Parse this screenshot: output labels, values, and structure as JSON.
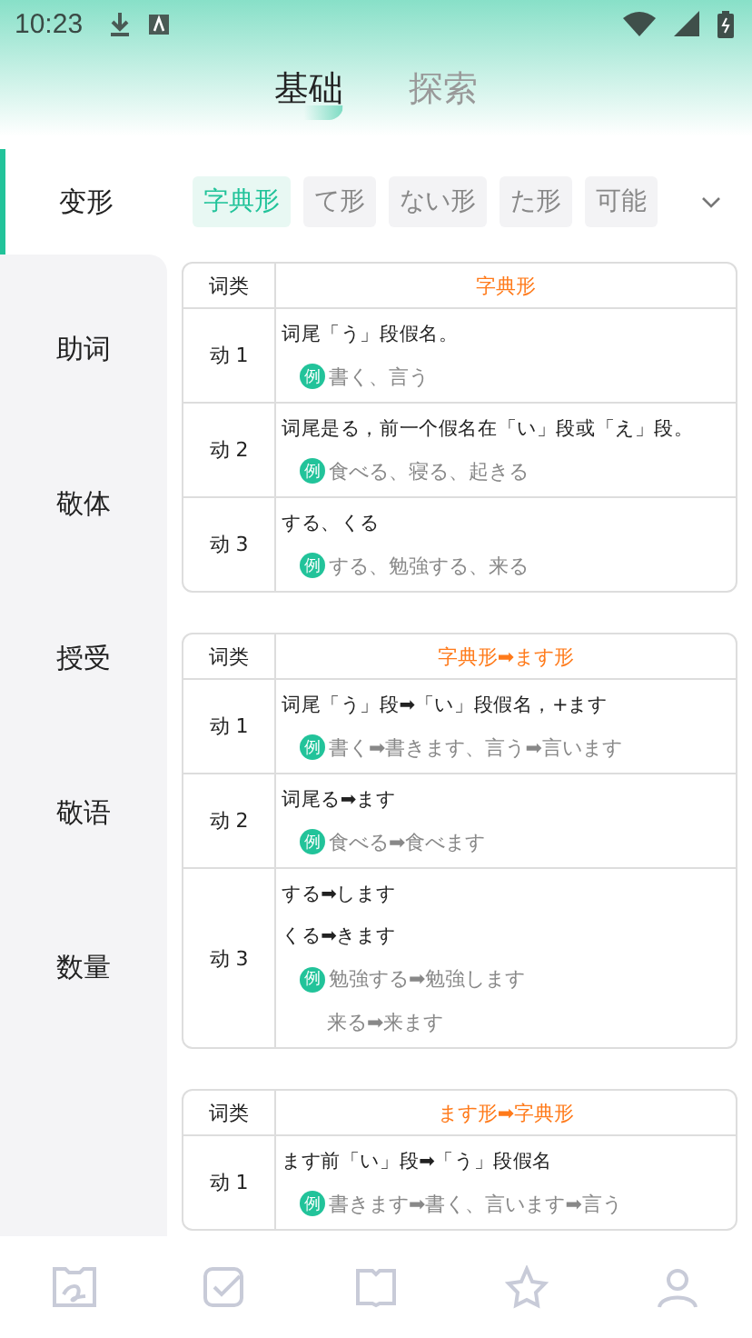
{
  "status_bar": {
    "time": "10:23"
  },
  "top_tabs": [
    {
      "label": "基础",
      "selected": true
    },
    {
      "label": "探索",
      "selected": false
    }
  ],
  "sidebar": {
    "items": [
      {
        "label": "变形",
        "selected": true
      },
      {
        "label": "助词",
        "selected": false
      },
      {
        "label": "敬体",
        "selected": false
      },
      {
        "label": "授受",
        "selected": false
      },
      {
        "label": "敬语",
        "selected": false
      },
      {
        "label": "数量",
        "selected": false
      }
    ]
  },
  "chips": [
    {
      "label": "字典形",
      "selected": true
    },
    {
      "label": "て形",
      "selected": false
    },
    {
      "label": "ない形",
      "selected": false
    },
    {
      "label": "た形",
      "selected": false
    },
    {
      "label": "可能",
      "selected": false
    }
  ],
  "tables": [
    {
      "col_head": "词类",
      "title": "字典形",
      "rows": [
        {
          "type": "动 1",
          "lines": [
            {
              "kind": "rule",
              "text": "词尾「う」段假名。"
            },
            {
              "kind": "example",
              "marker": "例",
              "text": "書く、言う"
            }
          ]
        },
        {
          "type": "动 2",
          "lines": [
            {
              "kind": "rule",
              "text": "词尾是る，前一个假名在「い」段或「え」段。"
            },
            {
              "kind": "example",
              "marker": "例",
              "text": "食べる、寝る、起きる"
            }
          ]
        },
        {
          "type": "动 3",
          "lines": [
            {
              "kind": "rule",
              "text": "する、くる"
            },
            {
              "kind": "example",
              "marker": "例",
              "text": "する、勉強する、来る"
            }
          ]
        }
      ]
    },
    {
      "col_head": "词类",
      "title": "字典形➡ます形",
      "rows": [
        {
          "type": "动 1",
          "lines": [
            {
              "kind": "rule",
              "text": "词尾「う」段➡「い」段假名，+ます"
            },
            {
              "kind": "example",
              "marker": "例",
              "text": "書く➡書きます、言う➡言います"
            }
          ]
        },
        {
          "type": "动 2",
          "lines": [
            {
              "kind": "rule",
              "text": "词尾る➡ます"
            },
            {
              "kind": "example",
              "marker": "例",
              "text": "食べる➡食べます"
            }
          ]
        },
        {
          "type": "动 3",
          "lines": [
            {
              "kind": "rule",
              "text": "する➡します"
            },
            {
              "kind": "rule",
              "text": "くる➡きます"
            },
            {
              "kind": "example",
              "marker": "例",
              "text": "勉強する➡勉強します"
            },
            {
              "kind": "continuation",
              "text": "来る➡来ます"
            }
          ]
        }
      ]
    },
    {
      "col_head": "词类",
      "title": "ます形➡字典形",
      "rows": [
        {
          "type": "动 1",
          "lines": [
            {
              "kind": "rule",
              "text": "ます前「い」段➡「う」段假名"
            },
            {
              "kind": "example",
              "marker": "例",
              "text": "書きます➡書く、言います➡言う"
            }
          ]
        }
      ]
    }
  ]
}
